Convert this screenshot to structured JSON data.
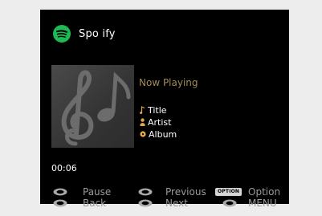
{
  "app": {
    "name": "Spo ify",
    "logo_icon": "spotify-logo-icon",
    "brand_color": "#1db954"
  },
  "album_art": {
    "icon": "music-notes-icon"
  },
  "now_playing": {
    "heading": "Now Playing",
    "title": "Title",
    "artist": "Artist",
    "album": "Album",
    "title_icon": "music-note-icon",
    "artist_icon": "person-icon",
    "album_icon": "disc-icon",
    "elapsed": "00:06"
  },
  "controls": {
    "pause_label": "Pause",
    "back_label": "Back",
    "previous_label": "Previous",
    "next_label": "Next",
    "option_badge": "OPTION",
    "option_label": "Option",
    "menu_label": "MENU"
  },
  "colors": {
    "screen_bg": "#000000",
    "accent_heading": "#a08a58",
    "control_text": "#9a9a9a"
  }
}
